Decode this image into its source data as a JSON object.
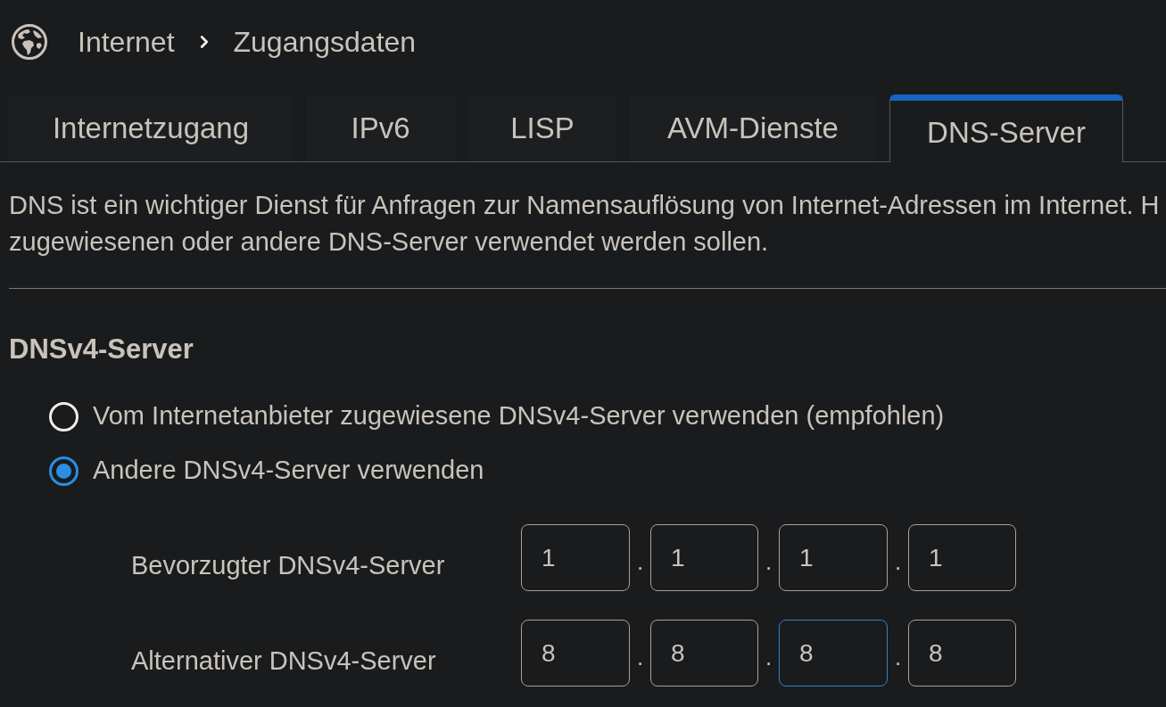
{
  "breadcrumb": {
    "items": [
      "Internet",
      "Zugangsdaten"
    ]
  },
  "tabs": [
    {
      "label": "Internetzugang",
      "selected": false
    },
    {
      "label": "IPv6",
      "selected": false
    },
    {
      "label": "LISP",
      "selected": false
    },
    {
      "label": "AVM-Dienste",
      "selected": false
    },
    {
      "label": "DNS-Server",
      "selected": true
    }
  ],
  "description": {
    "lines": [
      "DNS ist ein wichtiger Dienst für Anfragen zur Namensauflösung von Internet-Adressen im Internet. H",
      "zugewiesenen oder andere DNS-Server verwendet werden sollen."
    ]
  },
  "section": {
    "title": "DNSv4-Server",
    "options": [
      {
        "label": "Vom Internetanbieter zugewiesene DNSv4-Server verwenden (empfohlen)",
        "selected": false
      },
      {
        "label": "Andere DNSv4-Server verwenden",
        "selected": true
      }
    ],
    "servers": [
      {
        "label": "Bevorzugter DNSv4-Server",
        "octets": [
          {
            "value": "1",
            "focused": false,
            "separator": "."
          },
          {
            "value": "1",
            "focused": false,
            "separator": "."
          },
          {
            "value": "1",
            "focused": false,
            "separator": "."
          },
          {
            "value": "1",
            "focused": false
          }
        ]
      },
      {
        "label": "Alternativer DNSv4-Server",
        "octets": [
          {
            "value": "8",
            "focused": false,
            "separator": "."
          },
          {
            "value": "8",
            "focused": false,
            "separator": "."
          },
          {
            "value": "8",
            "focused": true,
            "separator": "."
          },
          {
            "value": "8",
            "focused": false
          }
        ]
      }
    ]
  }
}
